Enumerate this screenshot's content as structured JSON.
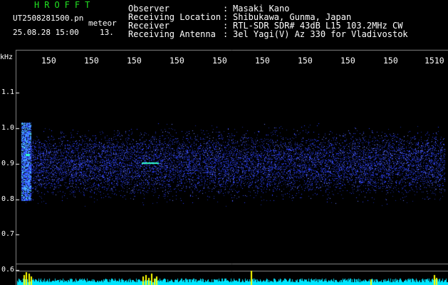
{
  "header": {
    "app_title": "HROFFT",
    "filename": "UT2508281500.pn",
    "filename_suffix": "meteor",
    "timestamp": "25.08.28 15:00",
    "channel": "13.",
    "fields": [
      {
        "label": "Observer",
        "value": "Masaki Kano"
      },
      {
        "label": "Receiving Location",
        "value": "Shibukawa, Gunma, Japan"
      },
      {
        "label": "Receiver",
        "value": "RTL-SDR SDR# 43dB L15 103.2MHz CW"
      },
      {
        "label": "Receiving Antenna",
        "value": "3el Yagi(V) Az 330 for Vladivostok"
      }
    ],
    "separator": ":"
  },
  "axes": {
    "y_unit": "kHz",
    "y_ticks": [
      "1.1",
      "1.0",
      "0.9",
      "0.8",
      "0.7",
      "0.6"
    ],
    "x_ticks": [
      "150",
      "150",
      "150",
      "150",
      "150",
      "150",
      "150",
      "150",
      "150",
      "1510"
    ]
  },
  "colors": {
    "background": "#000000",
    "title": "#22e022",
    "text": "#ffffff",
    "noise": "#2a3cff",
    "echo": "#33ffcc",
    "baseline": "#00e5ff",
    "spike": "#ffff00",
    "gridline": "#8a8a8a"
  }
}
